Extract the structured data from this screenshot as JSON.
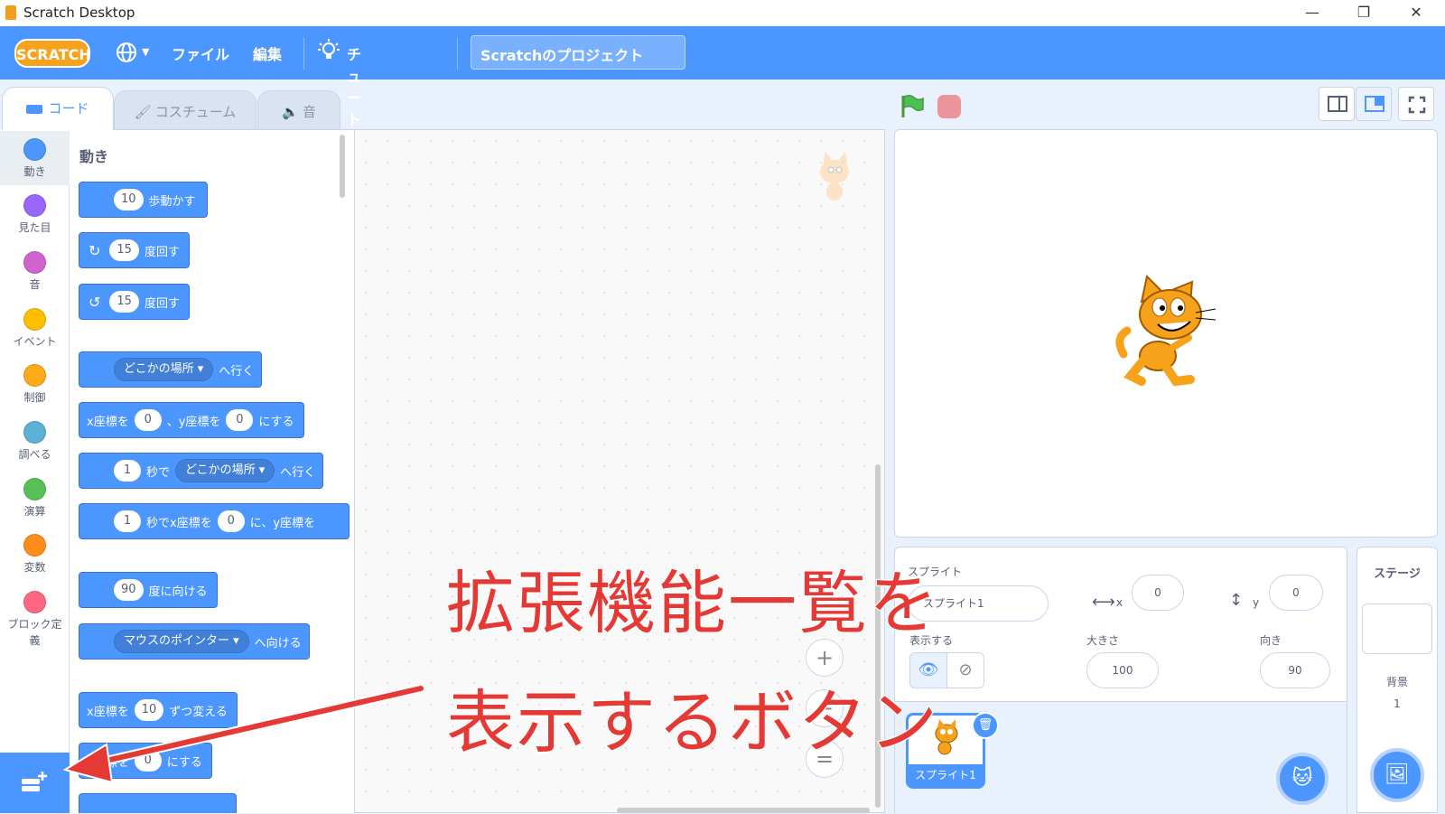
{
  "window": {
    "title": "Scratch Desktop",
    "minimize": "—",
    "maximize": "❐",
    "close": "✕"
  },
  "menubar": {
    "logo": "SCRATCH",
    "language_icon": "globe-icon",
    "file": "ファイル",
    "edit": "編集",
    "tutorial": "チュートリアル",
    "project_title": "Scratchのプロジェクト"
  },
  "tabs": {
    "code": "コード",
    "costumes": "コスチューム",
    "sounds": "音"
  },
  "categories": [
    {
      "label": "動き",
      "color": "#4c97ff"
    },
    {
      "label": "見た目",
      "color": "#9966ff"
    },
    {
      "label": "音",
      "color": "#cf63cf"
    },
    {
      "label": "イベント",
      "color": "#ffbf00"
    },
    {
      "label": "制御",
      "color": "#ffab19"
    },
    {
      "label": "調べる",
      "color": "#5cb1d6"
    },
    {
      "label": "演算",
      "color": "#59c059"
    },
    {
      "label": "変数",
      "color": "#ff8c1a"
    },
    {
      "label": "ブロック定義",
      "color": "#ff6680"
    }
  ],
  "palette": {
    "section_title": "動き",
    "move": {
      "value": "10",
      "text": "歩動かす"
    },
    "turn_right": {
      "value": "15",
      "text": "度回す"
    },
    "turn_left": {
      "value": "15",
      "text": "度回す"
    },
    "goto": {
      "menu": "どこかの場所 ▾",
      "text": "へ行く"
    },
    "gotoxy": {
      "a": "x座標を",
      "x": "0",
      "b": "、y座標を",
      "y": "0",
      "c": "にする"
    },
    "glide_to": {
      "value": "1",
      "a": "秒で",
      "menu": "どこかの場所 ▾",
      "b": "へ行く"
    },
    "glide_xy": {
      "value": "1",
      "a": "秒でx座標を",
      "x": "0",
      "b": "に、y座標を"
    },
    "point_dir": {
      "value": "90",
      "text": "度に向ける"
    },
    "point_towards": {
      "menu": "マウスのポインター ▾",
      "text": "へ向ける"
    },
    "change_x": {
      "a": "x座標を",
      "value": "10",
      "b": "ずつ変える"
    },
    "set_x": {
      "a": "x座標を",
      "value": "0",
      "b": "にする"
    }
  },
  "zoom": {
    "in": "+",
    "out": "−",
    "reset": "="
  },
  "sprite_info": {
    "sprite_label": "スプライト",
    "sprite_name": "スプライト1",
    "x_label": "x",
    "x_value": "0",
    "y_label": "y",
    "y_value": "0",
    "show_label": "表示する",
    "size_label": "大きさ",
    "size_value": "100",
    "direction_label": "向き",
    "direction_value": "90"
  },
  "sprite_list": [
    {
      "name": "スプライト1"
    }
  ],
  "stage_pane": {
    "title": "ステージ",
    "backdrops_label": "背景",
    "backdrops_count": "1"
  },
  "annotation": {
    "line1": "拡張機能一覧を",
    "line2": "表示するボタン"
  },
  "colors": {
    "accent": "#4c97ff",
    "annotation": "#e53935"
  }
}
